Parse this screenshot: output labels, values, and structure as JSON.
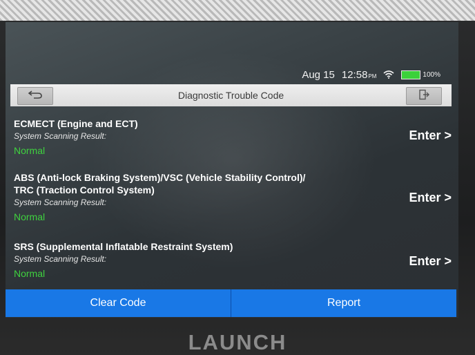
{
  "status_bar": {
    "date": "Aug 15",
    "time": "12:58",
    "ampm": "PM",
    "battery": "100%"
  },
  "title_bar": {
    "title": "Diagnostic Trouble Code"
  },
  "systems": [
    {
      "name_lines": [
        "ECMECT (Engine and ECT)"
      ],
      "scan_label": "System Scanning Result:",
      "result": "Normal",
      "enter_label": "Enter >"
    },
    {
      "name_lines": [
        "ABS (Anti-lock Braking System)/VSC (Vehicle Stability Control)/",
        "TRC (Traction Control System)"
      ],
      "scan_label": "System Scanning Result:",
      "result": "Normal",
      "enter_label": "Enter >"
    },
    {
      "name_lines": [
        "SRS (Supplemental Inflatable Restraint System)"
      ],
      "scan_label": "System Scanning Result:",
      "result": "Normal",
      "enter_label": "Enter >"
    }
  ],
  "actions": {
    "clear_code": "Clear Code",
    "report": "Report"
  },
  "brand": "LAUNCH",
  "colors": {
    "accent_blue": "#1978e6",
    "normal_green": "#3fd23f",
    "battery_green": "#3bd13b"
  },
  "icons": [
    "back-arrow-icon",
    "exit-icon",
    "wifi-icon",
    "battery-icon"
  ]
}
